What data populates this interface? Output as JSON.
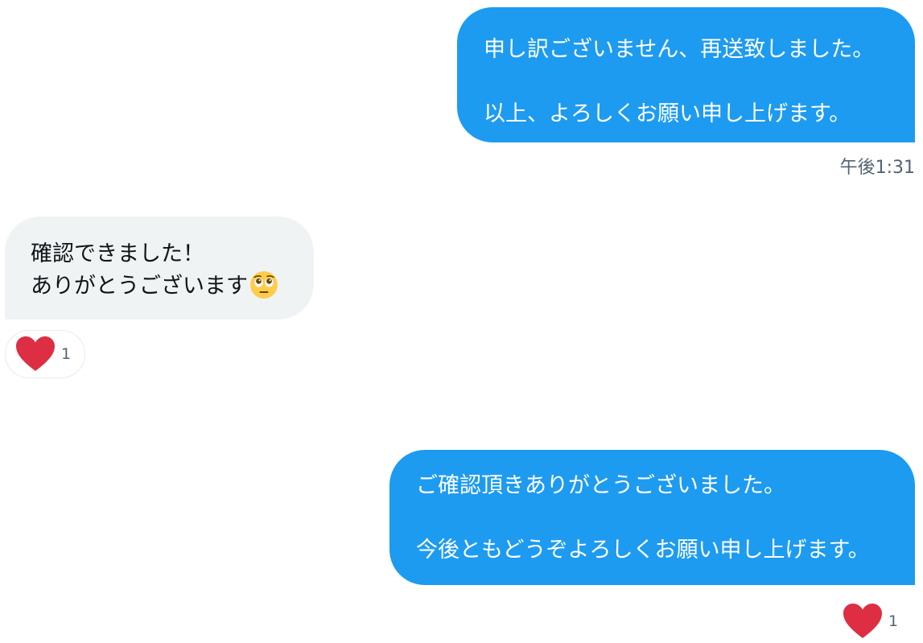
{
  "messages": [
    {
      "direction": "sent",
      "lines": [
        "申し訳ございません、再送致しました。",
        "以上、よろしくお願い申し上げます。"
      ]
    },
    {
      "direction": "received",
      "lines": [
        "確認できました！",
        "ありがとうございます"
      ],
      "emoji": "pleading-face-icon"
    },
    {
      "direction": "sent",
      "lines": [
        "ご確認頂きありがとうございました。",
        "今後ともどうぞよろしくお願い申し上げます。"
      ]
    }
  ],
  "timestamp": "午後1:31",
  "reactions": [
    {
      "icon": "heart-icon",
      "count": "1"
    },
    {
      "icon": "heart-icon",
      "count": "1"
    }
  ],
  "colors": {
    "sent_bubble": "#1d9bf0",
    "received_bubble": "#eff3f4",
    "heart": "#e0245e"
  }
}
